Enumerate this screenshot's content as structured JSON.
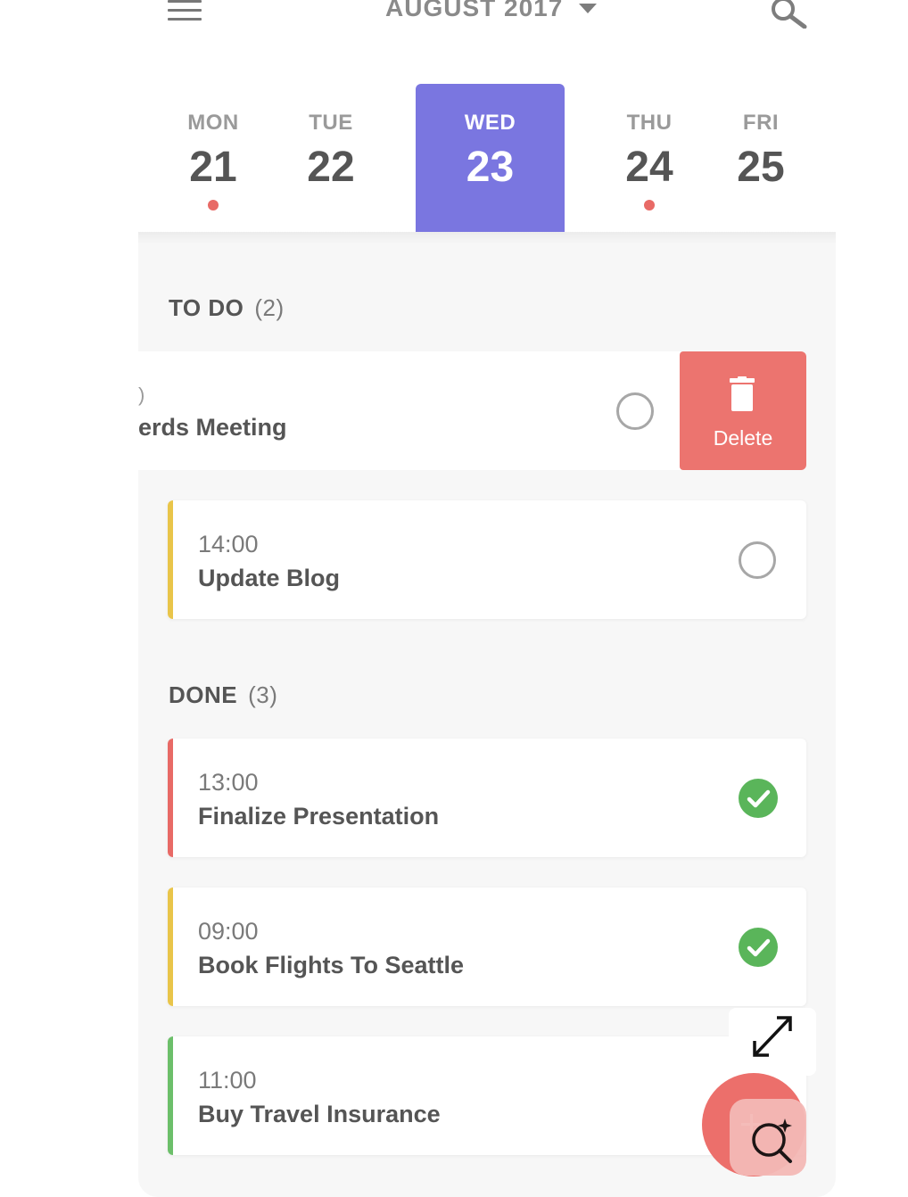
{
  "header": {
    "month_label": "AUGUST 2017",
    "menu_icon": "hamburger-menu-icon",
    "search_icon": "search-icon",
    "dropdown_icon": "caret-down-icon"
  },
  "days": [
    {
      "name": "MON",
      "num": "21",
      "has_dot": true,
      "selected": false
    },
    {
      "name": "TUE",
      "num": "22",
      "has_dot": false,
      "selected": false
    },
    {
      "name": "WED",
      "num": "23",
      "has_dot": false,
      "selected": true
    },
    {
      "name": "THU",
      "num": "24",
      "has_dot": true,
      "selected": false
    },
    {
      "name": "FRI",
      "num": "25",
      "has_dot": false,
      "selected": false
    }
  ],
  "todo": {
    "title": "TO DO",
    "count": "(2)",
    "swiped_item": {
      "time_fragment": ")",
      "name_fragment": "erds Meeting",
      "delete_label": "Delete"
    },
    "items": [
      {
        "time": "14:00",
        "name": "Update Blog",
        "color": "#e9c54a"
      }
    ]
  },
  "done": {
    "title": "DONE",
    "count": "(3)",
    "items": [
      {
        "time": "13:00",
        "name": "Finalize Presentation",
        "color": "#e86a66"
      },
      {
        "time": "09:00",
        "name": "Book Flights To Seattle",
        "color": "#e9c54a"
      },
      {
        "time": "11:00",
        "name": "Buy Travel Insurance",
        "color": "#6cbf6a"
      }
    ]
  },
  "colors": {
    "accent": "#7a76e0",
    "delete": "#ec746f",
    "done_check": "#5ab55a",
    "dot": "#e86a66"
  }
}
